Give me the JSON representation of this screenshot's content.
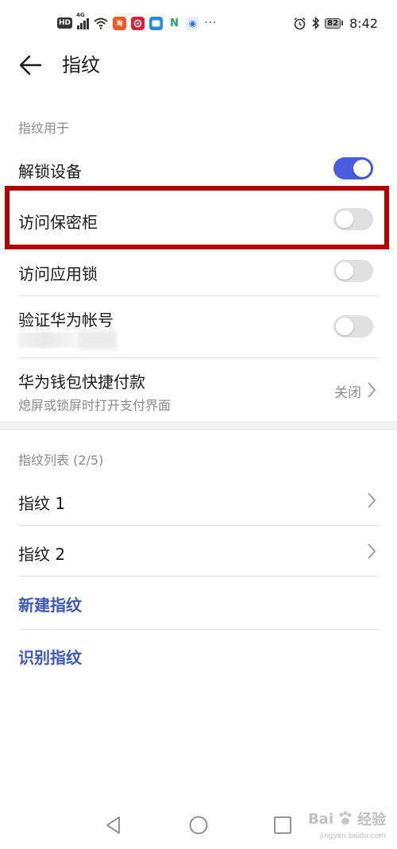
{
  "status_bar": {
    "hd": "HD",
    "network": "4G",
    "time": "8:42",
    "battery": "82",
    "more": "···"
  },
  "header": {
    "title": "指纹"
  },
  "sections": {
    "usage_label": "指纹用于",
    "list_label": "指纹列表 (2/5)"
  },
  "usage_items": [
    {
      "title": "解锁设备",
      "toggle": true
    },
    {
      "title": "访问保密柜",
      "toggle": false
    },
    {
      "title": "访问应用锁",
      "toggle": false
    },
    {
      "title": "验证华为帐号",
      "toggle": false
    }
  ],
  "wallet": {
    "title": "华为钱包快捷付款",
    "subtitle": "熄屏或锁屏时打开支付界面",
    "value": "关闭"
  },
  "fingerprints": [
    {
      "label": "指纹 1"
    },
    {
      "label": "指纹 2"
    }
  ],
  "actions": {
    "new": "新建指纹",
    "identify": "识别指纹"
  },
  "watermark": {
    "brand": "Bai",
    "brand_suffix": "经验",
    "url": "jingyan.baidu.com"
  },
  "colors": {
    "accent": "#4a5ce0",
    "link": "#3c58b4",
    "highlight": "#b30000"
  }
}
